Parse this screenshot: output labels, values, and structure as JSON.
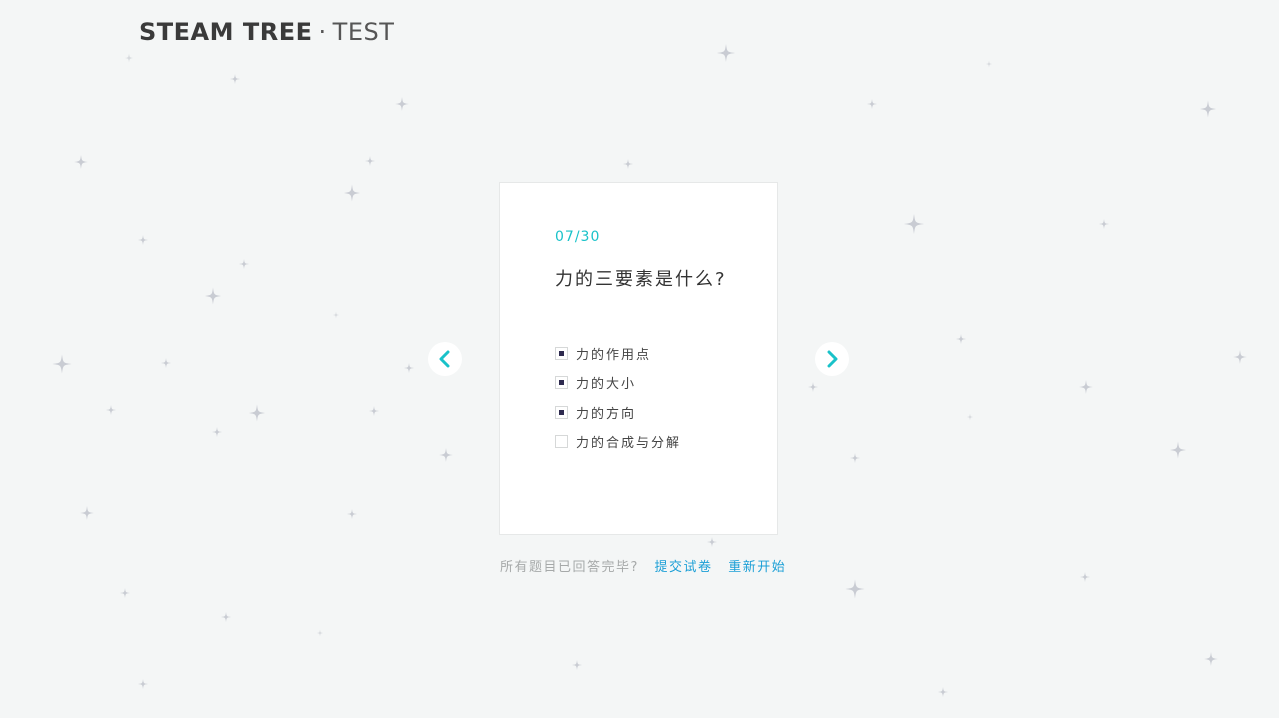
{
  "brand": {
    "name": "STEAM TREE",
    "separator": "·",
    "suffix": "TEST"
  },
  "quiz": {
    "progress": "07/30",
    "question": "力的三要素是什么?",
    "options": [
      {
        "label": "力的作用点",
        "checked": true
      },
      {
        "label": "力的大小",
        "checked": true
      },
      {
        "label": "力的方向",
        "checked": true
      },
      {
        "label": "力的合成与分解",
        "checked": false
      }
    ]
  },
  "nav": {
    "prev_icon": "chevron-left-icon",
    "next_icon": "chevron-right-icon"
  },
  "footer": {
    "question": "所有题目已回答完毕?",
    "submit_label": "提交试卷",
    "restart_label": "重新开始"
  },
  "colors": {
    "background": "#f4f6f6",
    "accent": "#19c2c9",
    "link": "#1b9fd6",
    "checkbox_fill": "#2e2a4f",
    "star": "#c9ccd3"
  }
}
